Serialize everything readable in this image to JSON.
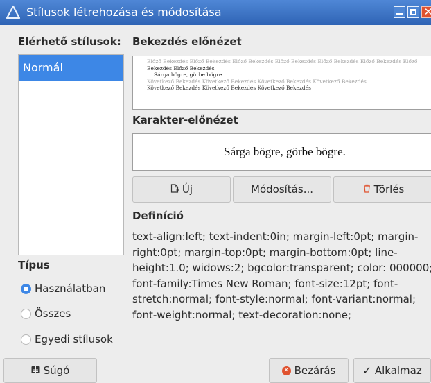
{
  "window": {
    "title": "Stílusok létrehozása és módosítása",
    "close_glyph": "✕"
  },
  "left": {
    "available_styles_label": "Elérhető stílusok:",
    "styles": [
      "Normál"
    ],
    "type_label": "Típus",
    "types": [
      {
        "label": "Használatban",
        "selected": true
      },
      {
        "label": "Összes",
        "selected": false
      },
      {
        "label": "Egyedi stílusok",
        "selected": false
      }
    ]
  },
  "paragraph_preview": {
    "label": "Bekezdés előnézet",
    "previous_line": "Előző Bekezdés Előző Bekezdés Előző Bekezdés Előző Bekezdés Előző Bekezdés Előző Bekezdés Előző",
    "previous_line2": "Bekezdés Előző Bekezdés",
    "sample": "Sárga bögre, görbe bögre.",
    "next_line": "Következő Bekezdés Következő Bekezdés Következő Bekezdés Következő Bekezdés",
    "next_line2": "Következő Bekezdés Következő Bekezdés Következő Bekezdés"
  },
  "character_preview": {
    "label": "Karakter-előnézet",
    "sample": "Sárga bögre, görbe bögre."
  },
  "actions": {
    "new": {
      "label": "Új",
      "icon": "new-document-icon"
    },
    "modify": {
      "label": "Módosítás..."
    },
    "delete": {
      "label": "Törlés",
      "icon": "trash-icon"
    }
  },
  "definition": {
    "label": "Definíció",
    "text": "text-align:left; text-indent:0in; margin-left:0pt; margin-right:0pt; margin-top:0pt; margin-bottom:0pt; line-height:1.0; widows:2; bgcolor:transparent; color: 000000; font-family:Times New Roman; font-size:12pt; font-stretch:normal; font-style:normal; font-variant:normal; font-weight:normal; text-decoration:none;"
  },
  "footer": {
    "help": {
      "label": "Súgó",
      "icon": "help-icon"
    },
    "close": {
      "label": "Bezárás",
      "icon": "close-circle-icon"
    },
    "apply": {
      "label": "Alkalmaz",
      "icon": "check-icon"
    }
  },
  "colors": {
    "accent": "#3d87e6",
    "titlebar": "#2f64b5",
    "close_red": "#e0522f"
  }
}
